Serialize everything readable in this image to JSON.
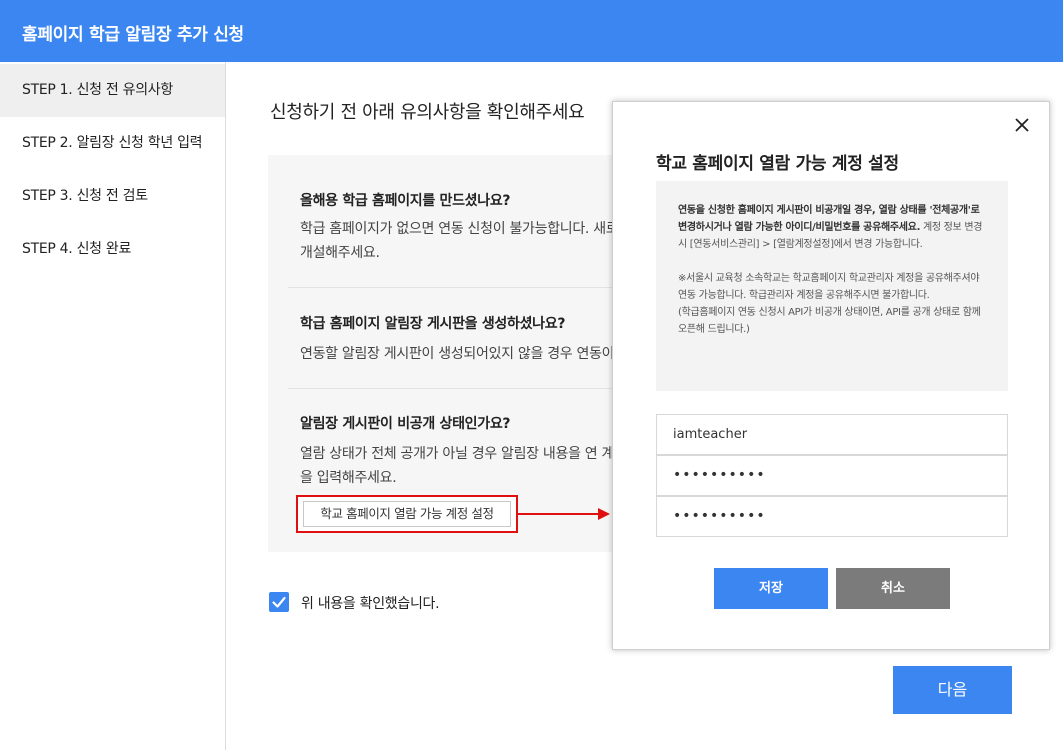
{
  "header": {
    "title": "홈페이지 학급 알림장 추가 신청"
  },
  "sidebar": {
    "steps": [
      {
        "label": "STEP 1. 신청 전 유의사항",
        "active": true
      },
      {
        "label": "STEP 2. 알림장 신청 학년 입력",
        "active": false
      },
      {
        "label": "STEP 3. 신청 전 검토",
        "active": false
      },
      {
        "label": "STEP 4. 신청 완료",
        "active": false
      }
    ]
  },
  "main": {
    "title": "신청하기 전 아래 유의사항을 확인해주세요",
    "notices": [
      {
        "question": "올해용 학급 홈페이지를 만드셨나요?",
        "answer": "학급 홈페이지가 없으면 연동 신청이 불가능합니다. 새로 개설해주세요."
      },
      {
        "question": "학급 홈페이지 알림장 게시판을 생성하셨나요?",
        "answer": "연동할 알림장 게시판이 생성되어있지 않을 경우 연동이"
      },
      {
        "question": "알림장 게시판이 비공개 상태인가요?",
        "answer": "열람 상태가 전체 공개가 아닐 경우 알림장 내용을 연 계정을 입력해주세요."
      }
    ],
    "account_button": "학교 홈페이지 열람 가능 계정 설정",
    "confirm_label": "위 내용을 확인했습니다.",
    "confirm_checked": true,
    "next_button": "다음"
  },
  "modal": {
    "title": "학교 홈페이지 열람 가능 계정 설정",
    "info": {
      "p1_bold": "연동을 신청한 홈페이지 게시판이 비공개일 경우, 열람 상태를 '전체공개'로 변경하시거나 열람 가능한 아이디/비밀번호를 공유해주세요.",
      "p1_rest": " 계정 정보 변경시 [연동서비스관리] > [열람계정설정]에서 변경 가능합니다.",
      "p2": "※서울시 교육청 소속학교는 학교홈페이지 학교관리자 계정을 공유해주셔야 연동 가능합니다. 학급관리자 계정을 공유해주시면 불가합니다.",
      "p3": "(학급홈페이지 연동 신청시 API가 비공개 상태이면, API를 공개 상태로 함께 오픈해 드립니다.)"
    },
    "fields": {
      "id_value": "iamteacher",
      "password_value": "••••••••••",
      "password_confirm_value": "••••••••••"
    },
    "save_button": "저장",
    "cancel_button": "취소"
  },
  "colors": {
    "primary": "#3b86f0",
    "highlight": "#e01010",
    "cancel": "#7b7b7b"
  }
}
